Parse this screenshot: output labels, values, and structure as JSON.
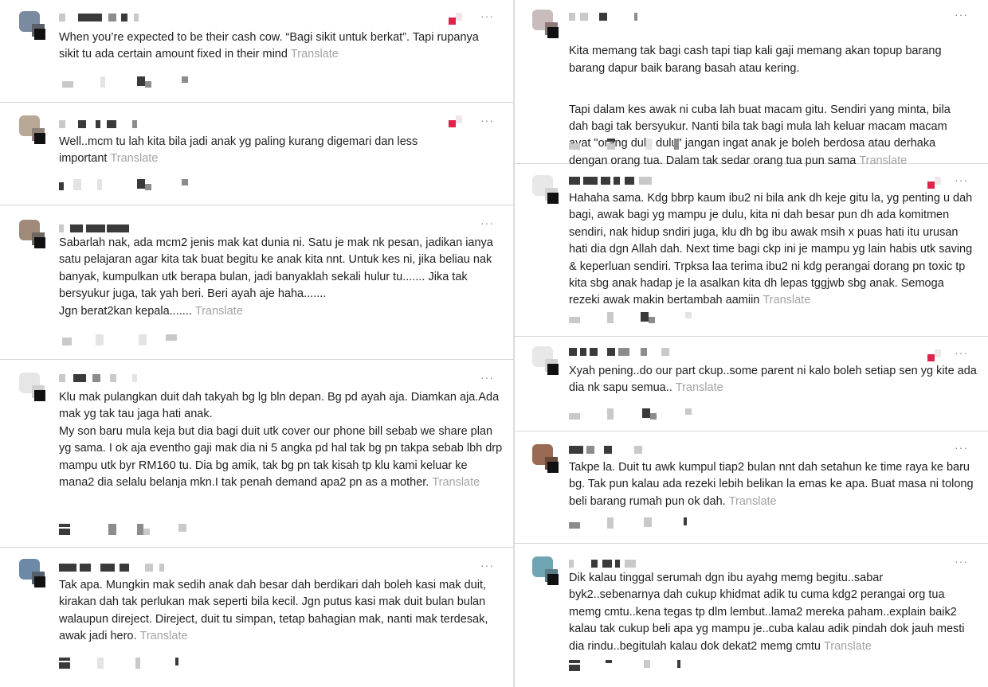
{
  "ui": {
    "translate_label": "Translate",
    "more_label": "···"
  },
  "comments_left": [
    {
      "text": "When you’re expected to be their cash cow. “Bagi sikit untuk berkat”. Tapi rupanya sikit tu ada certain amount fixed in their mind",
      "has_red_mark": true
    },
    {
      "text": "Well..mcm tu lah kita bila jadi anak yg paling kurang digemari dan less important",
      "has_red_mark": true
    },
    {
      "text": "Sabarlah nak, ada mcm2 jenis mak kat dunia ni. Satu je mak nk pesan, jadikan ianya satu pelajaran agar kita tak buat begitu ke anak kita nnt. Untuk kes ni, jika beliau nak banyak, kumpulkan utk berapa bulan, jadi banyaklah sekali hulur tu....... Jika tak bersyukur juga, tak yah beri. Beri ayah aje haha.......\nJgn berat2kan kepala.......",
      "has_red_mark": false
    },
    {
      "text": "Klu mak pulangkan duit dah takyah bg lg bln depan. Bg pd ayah aja. Diamkan aja.Ada mak yg tak tau jaga hati anak.\nMy son baru mula keja but dia bagi duit utk cover our phone bill sebab we share plan yg sama. I ok aja eventho gaji mak dia ni 5 angka pd hal tak bg pn takpa sebab lbh drp mampu utk byr RM160 tu. Dia bg amik, tak bg pn tak kisah tp klu kami keluar ke mana2 dia selalu belanja mkn.I tak penah demand apa2 pn as a mother.",
      "has_red_mark": false
    },
    {
      "text": "Tak apa. Mungkin mak sedih anak dah besar dah berdikari dah boleh kasi mak duit, kirakan dah tak perlukan mak seperti bila kecil. Jgn putus kasi mak duit bulan bulan walaupun direject. Direject, duit tu simpan, tetap bahagian mak, nanti mak terdesak, awak jadi hero.",
      "has_red_mark": false
    }
  ],
  "comments_right": [
    {
      "text": "Kita memang tak bagi cash tapi tiap kali gaji memang akan topup barang barang dapur baik barang basah atau kering.",
      "text2": "Tapi dalam kes awak ni cuba lah buat macam gitu. Sendiri yang minta, bila dah bagi tak bersyukur. Nanti bila tak bagi mula lah keluar macam macam ayat \"orang dulu dulu\" jangan ingat anak je boleh berdosa atau derhaka dengan orang tua. Dalam tak sedar orang tua pun sama",
      "has_red_mark": false
    },
    {
      "text": "Hahaha sama. Kdg bbrp kaum ibu2 ni bila ank dh keje gitu la, yg penting u dah bagi, awak bagi yg mampu je dulu, kita ni dah besar pun dh ada komitmen sendiri, nak hidup sndiri juga, klu dh bg ibu awak msih x puas hati itu urusan hati dia dgn Allah dah. Next time bagi ckp ini je mampu yg lain habis utk saving & keperluan sendiri. Trpksa laa terima ibu2 ni kdg perangai dorang pn toxic tp kita sbg anak hadap je la asalkan kita dh lepas tggjwb sbg anak. Semoga rezeki awak makin bertambah aamiin",
      "has_red_mark": true
    },
    {
      "text": "Xyah pening..do our part ckup..some parent ni kalo boleh setiap sen yg kite ada dia nk sapu semua..",
      "has_red_mark": true
    },
    {
      "text": "Takpe la. Duit tu awk kumpul tiap2 bulan nnt dah setahun ke time raya ke baru bg. Tak pun kalau ada rezeki lebih belikan la emas ke apa. Buat masa ni tolong beli barang rumah pun ok dah.",
      "has_red_mark": false
    },
    {
      "text": "Dik kalau tinggal serumah dgn ibu ayahg memg begitu..sabar byk2..sebenarnya dah cukup khidmat adik tu cuma kdg2 perangai org tua memg cmtu..kena tegas tp dlm lembut..lama2 mereka paham..explain baik2 kalau tak cukup beli apa yg mampu je..cuba kalau adik pindah dok jauh mesti dia rindu..begitulah kalau dok dekat2 memg cmtu",
      "has_red_mark": false
    }
  ]
}
